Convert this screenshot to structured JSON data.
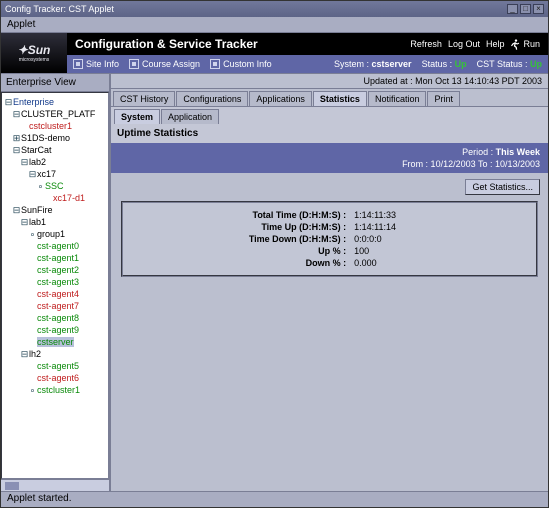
{
  "window": {
    "title": "Config Tracker: CST Applet"
  },
  "applet": {
    "label": "Applet"
  },
  "header": {
    "title": "Configuration & Service Tracker",
    "links": {
      "refresh": "Refresh",
      "logout": "Log Out",
      "help": "Help",
      "running": "Run"
    },
    "toolbar": {
      "site": "Site Info",
      "course": "Course Assign",
      "custom": "Custom Info"
    },
    "status": {
      "system_label": "System :",
      "system": "cstserver",
      "status_label": "Status :",
      "status": "Up",
      "cst_label": "CST Status :",
      "cst": "Up"
    }
  },
  "sidebar": {
    "title": "Enterprise View",
    "tree": [
      {
        "depth": 0,
        "label": "Enterprise",
        "cls": "blue",
        "toggle": "⊟"
      },
      {
        "depth": 1,
        "label": "CLUSTER_PLATF",
        "cls": "",
        "toggle": "⊟"
      },
      {
        "depth": 2,
        "label": "cstcluster1",
        "cls": "red",
        "toggle": ""
      },
      {
        "depth": 1,
        "label": "S1DS-demo",
        "cls": "",
        "toggle": "⊞"
      },
      {
        "depth": 1,
        "label": "StarCat",
        "cls": "",
        "toggle": "⊟"
      },
      {
        "depth": 2,
        "label": "lab2",
        "cls": "",
        "toggle": "⊟"
      },
      {
        "depth": 3,
        "label": "xc17",
        "cls": "",
        "toggle": "⊟"
      },
      {
        "depth": 4,
        "label": "SSC",
        "cls": "green",
        "toggle": "∘"
      },
      {
        "depth": 5,
        "label": "xc17-d1",
        "cls": "red",
        "toggle": ""
      },
      {
        "depth": 1,
        "label": "SunFire",
        "cls": "",
        "toggle": "⊟"
      },
      {
        "depth": 2,
        "label": "lab1",
        "cls": "",
        "toggle": "⊟"
      },
      {
        "depth": 3,
        "label": "group1",
        "cls": "",
        "toggle": "∘"
      },
      {
        "depth": 3,
        "label": "cst-agent0",
        "cls": "green",
        "toggle": ""
      },
      {
        "depth": 3,
        "label": "cst-agent1",
        "cls": "green",
        "toggle": ""
      },
      {
        "depth": 3,
        "label": "cst-agent2",
        "cls": "green",
        "toggle": ""
      },
      {
        "depth": 3,
        "label": "cst-agent3",
        "cls": "green",
        "toggle": ""
      },
      {
        "depth": 3,
        "label": "cst-agent4",
        "cls": "red",
        "toggle": ""
      },
      {
        "depth": 3,
        "label": "cst-agent7",
        "cls": "red",
        "toggle": ""
      },
      {
        "depth": 3,
        "label": "cst-agent8",
        "cls": "green",
        "toggle": ""
      },
      {
        "depth": 3,
        "label": "cst-agent9",
        "cls": "green",
        "toggle": ""
      },
      {
        "depth": 3,
        "label": "cstserver",
        "cls": "green sel",
        "toggle": ""
      },
      {
        "depth": 2,
        "label": "lh2",
        "cls": "",
        "toggle": "⊟"
      },
      {
        "depth": 3,
        "label": "cst-agent5",
        "cls": "green",
        "toggle": ""
      },
      {
        "depth": 3,
        "label": "cst-agent6",
        "cls": "red",
        "toggle": ""
      },
      {
        "depth": 3,
        "label": "cstcluster1",
        "cls": "green",
        "toggle": "∘"
      }
    ]
  },
  "content": {
    "updated": "Updated at :  Mon Oct 13 14:10:43 PDT 2003",
    "tabs": [
      "CST History",
      "Configurations",
      "Applications",
      "Statistics",
      "Notification",
      "Print"
    ],
    "active_tab": 3,
    "subtabs": [
      "System",
      "Application"
    ],
    "active_subtab": 0,
    "panel_title": "Uptime Statistics",
    "period": {
      "label": "Period :",
      "value": "This Week",
      "from": "From : 10/12/2003 To : 10/13/2003"
    },
    "get_stats": "Get Statistics...",
    "stats": [
      {
        "label": "Total Time (D:H:M:S) :",
        "value": "1:14:11:33"
      },
      {
        "label": "Time Up (D:H:M:S) :",
        "value": "1:14:11:14"
      },
      {
        "label": "Time Down (D:H:M:S) :",
        "value": "0:0:0:0"
      },
      {
        "label": "Up % :",
        "value": "100"
      },
      {
        "label": "Down % :",
        "value": "0.000"
      }
    ]
  },
  "statusbar": {
    "text": "Applet started."
  }
}
